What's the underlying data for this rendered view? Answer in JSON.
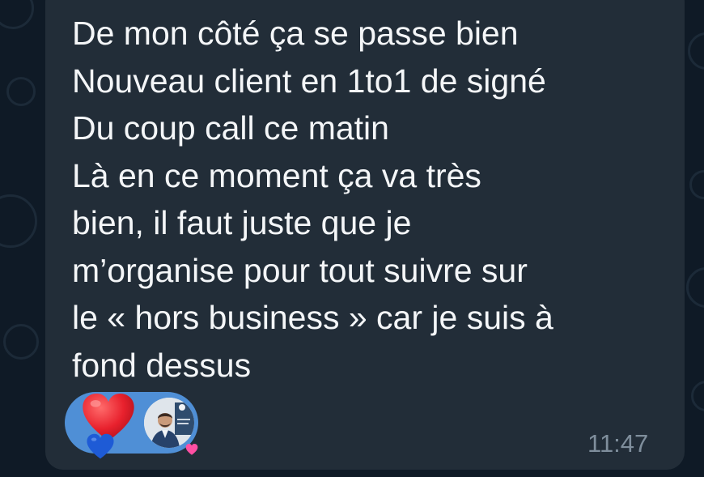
{
  "message": {
    "text": "De mon côté ça se passe bien\nNouveau client en 1to1 de signé\nDu coup call ce matin\nLà en ce moment ça va très\nbien, il faut juste que je\nm’organise pour tout suivre sur\nle « hors business » car je suis à\nfond dessus",
    "time": "11:47"
  },
  "reaction": {
    "emoji": "heart-icon",
    "colors": {
      "pill": "#4f8fd6",
      "heart": "#e8212d",
      "small_heart": "#1e5bd6",
      "pink_heart": "#ff4fa3"
    }
  },
  "theme": {
    "background": "#0f1a26",
    "bubble": "#222d38",
    "text": "#f4f6f8",
    "meta": "#7f8e9c"
  }
}
